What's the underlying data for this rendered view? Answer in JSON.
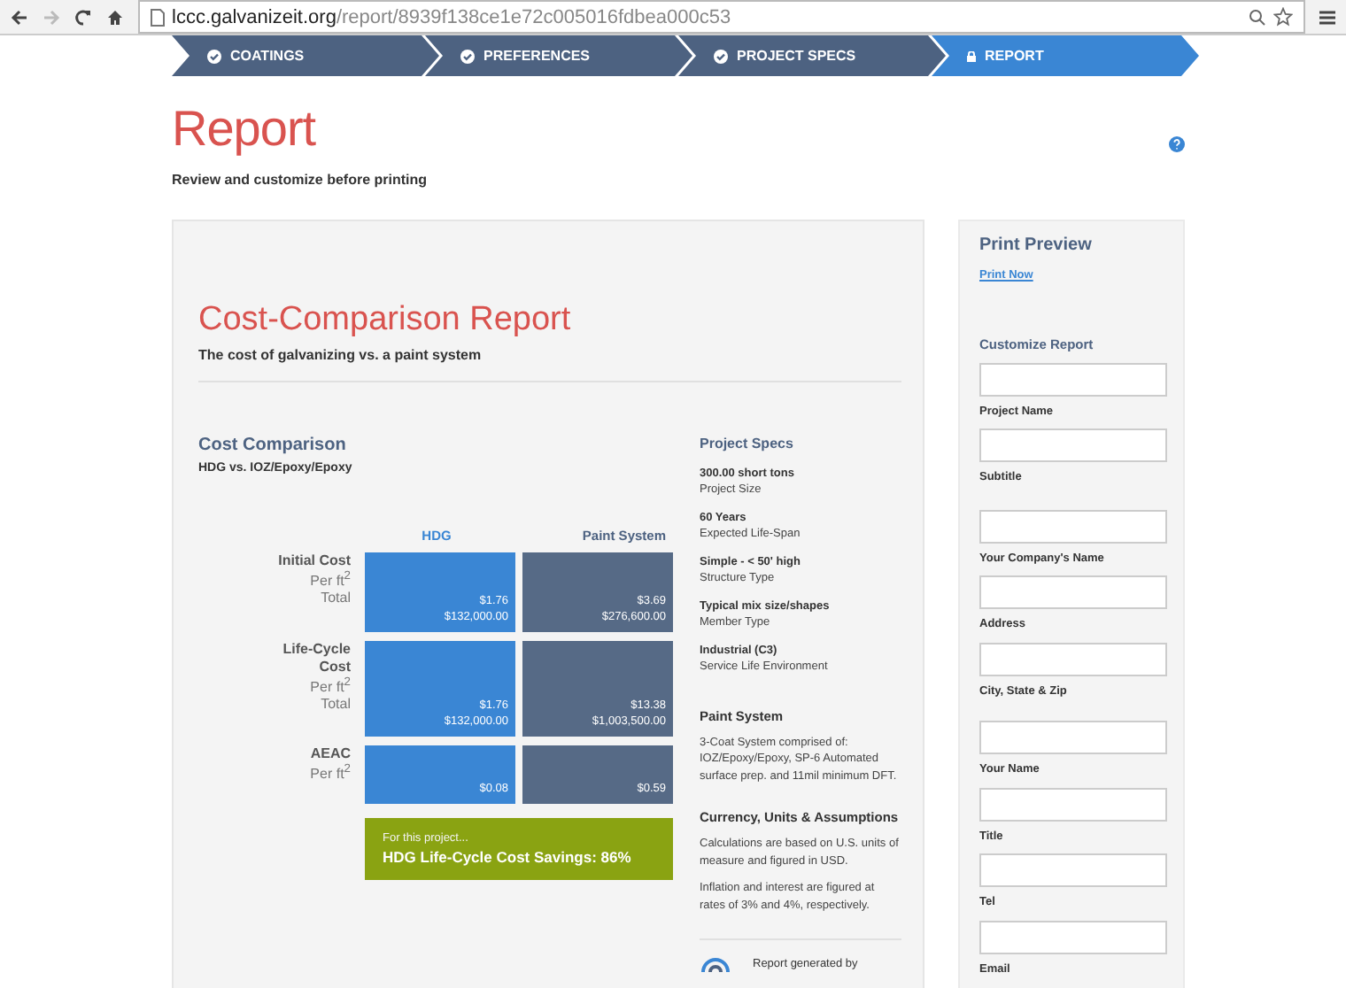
{
  "browser": {
    "url_host": "lccc.galvanizeit.org",
    "url_path": "/report/8939f138ce1e72c005016fdbea000c53"
  },
  "steps": [
    {
      "label": "COATINGS",
      "completed": true,
      "selected": false
    },
    {
      "label": "PREFERENCES",
      "completed": true,
      "selected": false
    },
    {
      "label": "PROJECT SPECS",
      "completed": true,
      "selected": false
    },
    {
      "label": "REPORT",
      "completed": false,
      "selected": true
    }
  ],
  "page": {
    "title": "Report",
    "subtitle": "Review and customize before printing"
  },
  "report": {
    "title": "Cost-Comparison Report",
    "subtitle": "The cost of galvanizing vs. a paint system",
    "comparison": {
      "title": "Cost Comparison",
      "subtitle": "HDG vs. IOZ/Epoxy/Epoxy",
      "columns": [
        "HDG",
        "Paint System"
      ],
      "rows": [
        {
          "label": "Initial Cost",
          "sublabels": [
            "Per ft$^{2}$",
            "Total"
          ],
          "hdg": [
            "$1.76",
            "$132,000.00"
          ],
          "paint": [
            "$3.69",
            "$276,600.00"
          ]
        },
        {
          "label": "Life-Cycle Cost",
          "sublabels": [
            "Per ft$^{2}$",
            "Total"
          ],
          "hdg": [
            "$1.76",
            "$132,000.00"
          ],
          "paint": [
            "$13.38",
            "$1,003,500.00"
          ]
        },
        {
          "label": "AEAC",
          "sublabels": [
            "Per ft$^{2}$"
          ],
          "hdg": [
            "$0.08"
          ],
          "paint": [
            "$0.59"
          ]
        }
      ],
      "savings": {
        "intro": "For this project...",
        "text": "HDG Life-Cycle Cost Savings: 86%"
      }
    },
    "specs": {
      "title": "Project Specs",
      "items": [
        {
          "value": "300.00 short tons",
          "label": "Project Size"
        },
        {
          "value": "60 Years",
          "label": "Expected Life-Span"
        },
        {
          "value": "Simple - < 50' high",
          "label": "Structure Type"
        },
        {
          "value": "Typical mix size/shapes",
          "label": "Member Type"
        },
        {
          "value": "Industrial (C3)",
          "label": "Service Life Environment"
        }
      ],
      "paint_title": "Paint System",
      "paint_text": "3-Coat System comprised of: IOZ/Epoxy/Epoxy, SP-6 Automated surface prep. and 11mil minimum DFT.",
      "assumptions_title": "Currency, Units & Assumptions",
      "assumptions": [
        "Calculations are based on U.S. units of measure and figured in USD.",
        "Inflation and interest are figured at rates of 3% and 4%, respectively."
      ],
      "footer": "Report generated by"
    }
  },
  "sidebar": {
    "title": "Print Preview",
    "link": "Print Now",
    "customize_title": "Customize Report",
    "fields": [
      "Project Name",
      "Subtitle",
      "Your Company's Name",
      "Address",
      "City, State & Zip",
      "Your Name",
      "Title",
      "Tel",
      "Email"
    ]
  }
}
